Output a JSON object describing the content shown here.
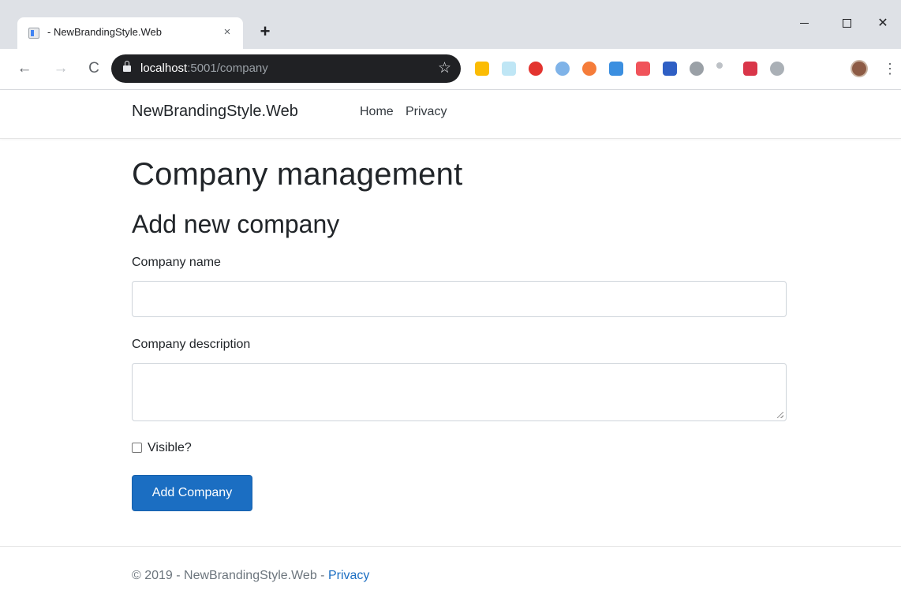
{
  "browser": {
    "tab_title": "- NewBrandingStyle.Web",
    "tab_close": "×",
    "new_tab": "+",
    "url_host": "localhost",
    "url_rest": ":5001/company",
    "star": "☆",
    "nav_back": "←",
    "nav_forward": "→",
    "nav_reload": "C",
    "menu": "⋮",
    "window_close": "✕"
  },
  "extensions": [
    {
      "name": "drive-icon",
      "color": "#fbbc04"
    },
    {
      "name": "react-icon",
      "color": "#bfe6f5"
    },
    {
      "name": "opera-icon",
      "color": "#e3342f"
    },
    {
      "name": "edge-icon",
      "color": "#7fb3e8"
    },
    {
      "name": "orange-icon",
      "color": "#f57c3a"
    },
    {
      "name": "window-icon",
      "color": "#3b8fe0"
    },
    {
      "name": "chat-icon",
      "color": "#f0535a"
    },
    {
      "name": "blue-square-icon",
      "color": "#2f5fc4"
    },
    {
      "name": "timer-icon",
      "color": "#9aa0a6"
    },
    {
      "name": "dots-icon",
      "color": "#bdc1c6"
    },
    {
      "name": "pocket-icon",
      "color": "#d93649"
    },
    {
      "name": "puzzle-icon",
      "color": "#aab0b6"
    }
  ],
  "navbar": {
    "brand": "NewBrandingStyle.Web",
    "links": [
      "Home",
      "Privacy"
    ]
  },
  "main": {
    "title": "Company management",
    "subtitle": "Add new company",
    "name_label": "Company name",
    "name_value": "",
    "description_label": "Company description",
    "description_value": "",
    "visible_label": "Visible?",
    "visible_checked": false,
    "submit_label": "Add Company"
  },
  "footer": {
    "text": "© 2019 - NewBrandingStyle.Web - ",
    "link": "Privacy"
  },
  "colors": {
    "primary": "#1b6ec2",
    "omnibox": "#202124"
  }
}
